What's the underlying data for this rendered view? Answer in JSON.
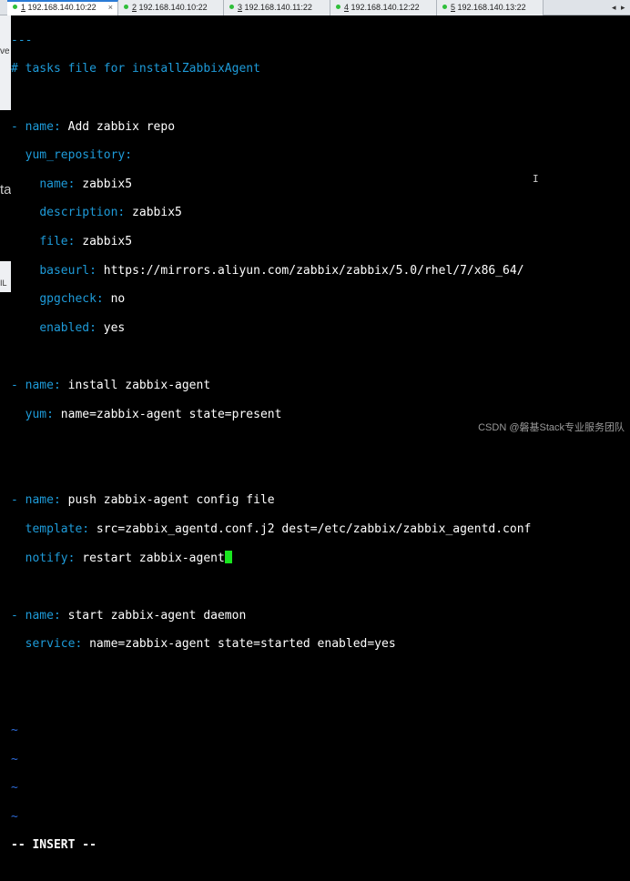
{
  "tabs": [
    {
      "num": "1",
      "label": "192.168.140.10:22",
      "active": true
    },
    {
      "num": "2",
      "label": "192.168.140.10:22",
      "active": false
    },
    {
      "num": "3",
      "label": "192.168.140.11:22",
      "active": false
    },
    {
      "num": "4",
      "label": "192.168.140.12:22",
      "active": false
    },
    {
      "num": "5",
      "label": "192.168.140.13:22",
      "active": false
    }
  ],
  "tab_close": "×",
  "tab_nav_prev": "◂",
  "tab_nav_next": "▸",
  "left_strip_chars": [
    "ve",
    "ta",
    "IL"
  ],
  "editor": {
    "separator": "---",
    "comment": "# tasks file for installZabbixAgent",
    "task1": {
      "name_key": "name:",
      "name_val": " Add zabbix repo",
      "module": "yum_repository:",
      "params": [
        {
          "key": "name:",
          "val": " zabbix5"
        },
        {
          "key": "description:",
          "val": " zabbix5"
        },
        {
          "key": "file:",
          "val": " zabbix5"
        },
        {
          "key": "baseurl:",
          "val": " https://mirrors.aliyun.com/zabbix/zabbix/5.0/rhel/7/x86_64/"
        },
        {
          "key": "gpgcheck:",
          "val": " no"
        },
        {
          "key": "enabled:",
          "val": " yes"
        }
      ]
    },
    "task2": {
      "name_key": "name:",
      "name_val": " install zabbix-agent",
      "mod_key": "yum:",
      "mod_val": " name=zabbix-agent state=present"
    },
    "task3": {
      "name_key": "name:",
      "name_val": " push zabbix-agent config file",
      "mod_key": "template:",
      "mod_val": " src=zabbix_agentd.conf.j2 dest=/etc/zabbix/zabbix_agentd.conf",
      "notify_key": "notify:",
      "notify_val": " restart zabbix-agent"
    },
    "task4": {
      "name_key": "name:",
      "name_val": " start zabbix-agent daemon",
      "mod_key": "service:",
      "mod_val": " name=zabbix-agent state=started enabled=yes"
    },
    "tilde": "~",
    "mode": "-- INSERT --"
  },
  "watermark": "CSDN @磐基Stack专业服务团队",
  "colors": {
    "key": "#1e9bd9",
    "tilde": "#2d6bd8",
    "cursor": "#19e61f",
    "tab_accent": "#2b7bd6"
  }
}
